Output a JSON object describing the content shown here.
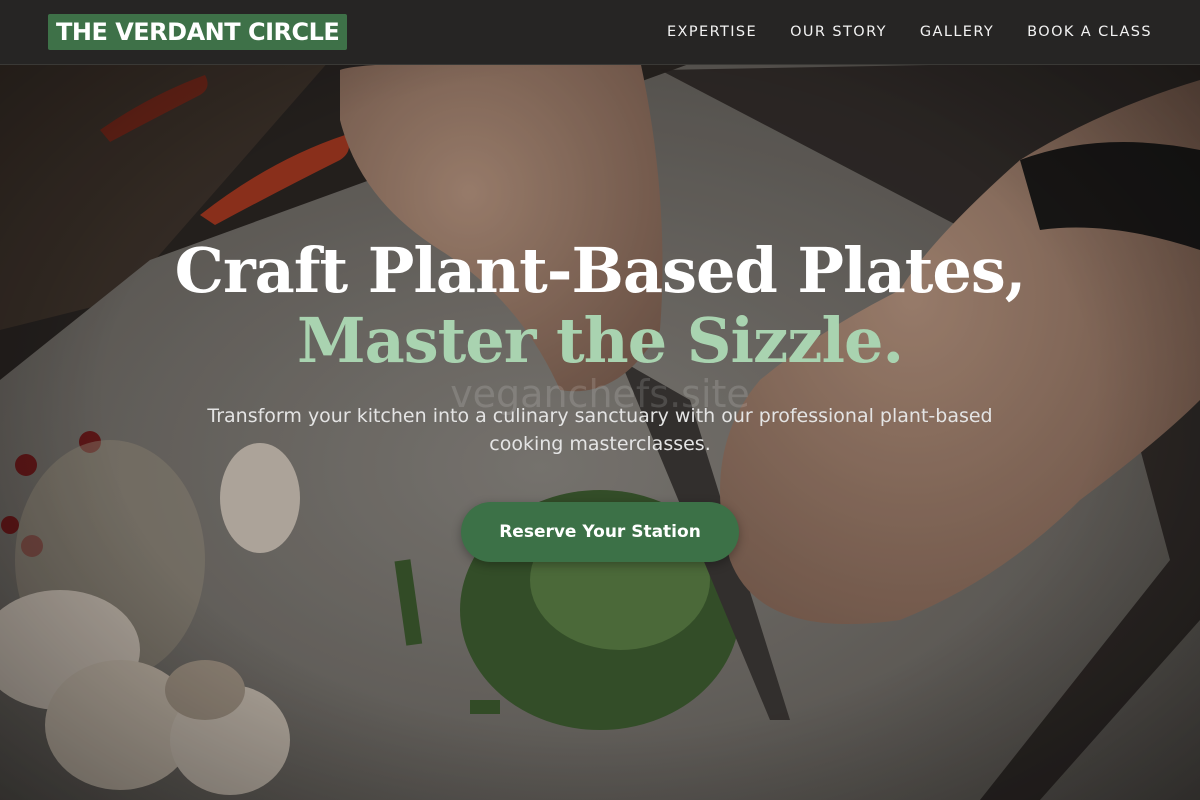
{
  "brand": {
    "logo_text": "THE VERDANT CIRCLE"
  },
  "nav": {
    "links": [
      {
        "label": "EXPERTISE"
      },
      {
        "label": "OUR STORY"
      },
      {
        "label": "GALLERY"
      },
      {
        "label": "BOOK A CLASS"
      }
    ]
  },
  "hero": {
    "headline_line1": "Craft Plant-Based Plates,",
    "headline_line2": "Master the Sizzle.",
    "subheadline": "Transform your kitchen into a culinary sanctuary with our professional plant-based cooking masterclasses.",
    "cta_label": "Reserve Your Station",
    "watermark": "veganchefs.site",
    "image": "hands-chopping-okra-on-cutting-board"
  },
  "colors": {
    "brand_green": "#3e7148",
    "accent_mint": "#a9d3b0",
    "nav_background": "#262524"
  }
}
